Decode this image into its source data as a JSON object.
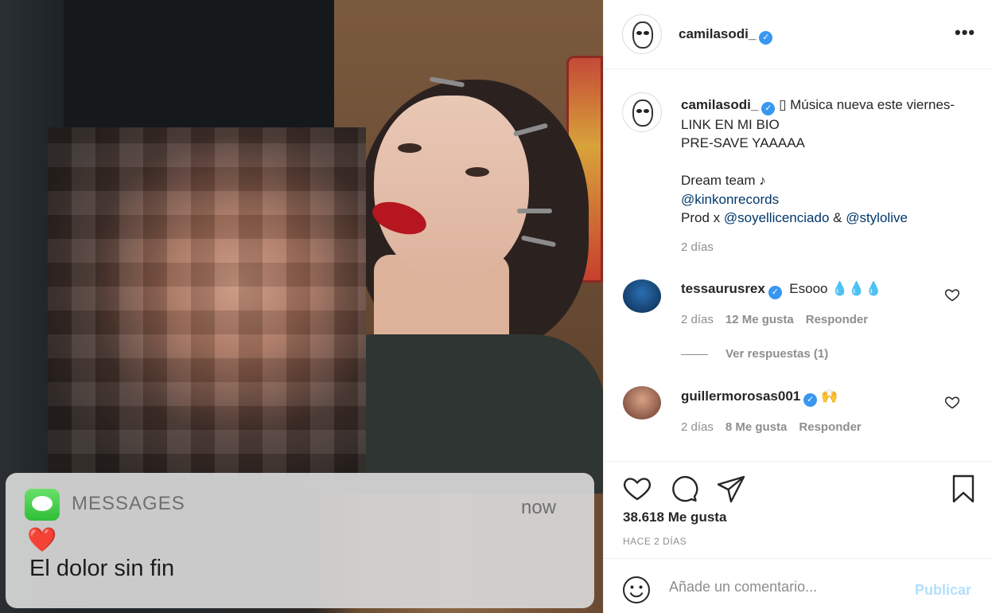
{
  "post": {
    "notification": {
      "app_name": "MESSAGES",
      "time": "now",
      "emoji": "❤️",
      "message": "El dolor sin fin"
    }
  },
  "header": {
    "username": "camilasodi_",
    "verified_icon": "verified-badge-icon",
    "more_icon": "more-options-icon",
    "more_label": "•••"
  },
  "caption": {
    "username": "camilasodi_",
    "line1": "▯ Música nueva este viernes- LINK EN MI BIO",
    "line2": "PRE-SAVE YAAAAA",
    "line3": "Dream team ♪",
    "mention1": "@kinkonrecords",
    "prod_prefix": "Prod x ",
    "mention2": "@soyellicenciado",
    "amp": " & ",
    "mention3": "@stylolive",
    "time": "2 días"
  },
  "comments": [
    {
      "username": "tessaurusrex",
      "text": "Esooo 💧💧💧",
      "time": "2 días",
      "likes": "12 Me gusta",
      "reply": "Responder",
      "view_replies": "Ver respuestas (1)"
    },
    {
      "username": "guillermorosas001",
      "text": "🙌",
      "time": "2 días",
      "likes": "8 Me gusta",
      "reply": "Responder"
    }
  ],
  "actions": {
    "likes": "38.618 Me gusta",
    "date": "HACE 2 DÍAS"
  },
  "add_comment": {
    "placeholder": "Añade un comentario...",
    "publish": "Publicar"
  },
  "colors": {
    "verified": "#3897f0",
    "link": "#00376b",
    "muted": "#8e8e8e",
    "publish_disabled": "#b2dffc"
  }
}
